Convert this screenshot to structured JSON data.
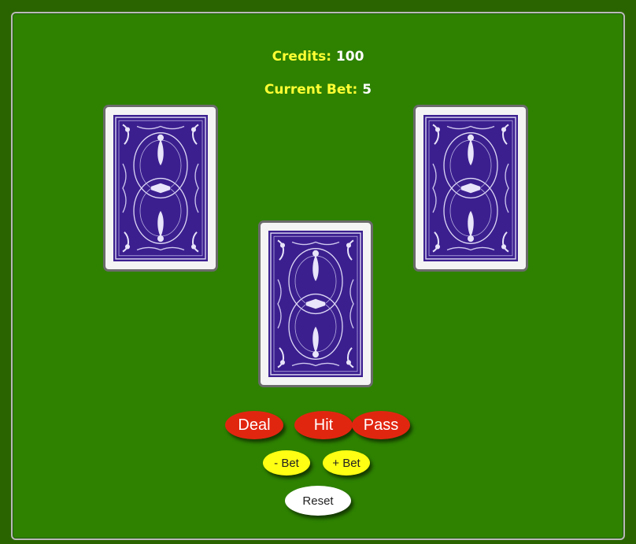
{
  "stats": {
    "credits_label": "Credits:",
    "credits_value": "100",
    "bet_label": "Current Bet:",
    "bet_value": "5"
  },
  "cards": [
    {
      "slot": "left",
      "face": "back"
    },
    {
      "slot": "center",
      "face": "back"
    },
    {
      "slot": "right",
      "face": "back"
    }
  ],
  "controls": {
    "deal_label": "Deal",
    "hit_label": "Hit",
    "pass_label": "Pass",
    "minus_bet_label": "- Bet",
    "plus_bet_label": "+ Bet",
    "reset_label": "Reset"
  },
  "colors": {
    "felt": "#2e8200",
    "card_back": "#3b1f8f",
    "action_button": "#e12610",
    "bet_button": "#ffff13",
    "label_text": "#ffff33"
  }
}
